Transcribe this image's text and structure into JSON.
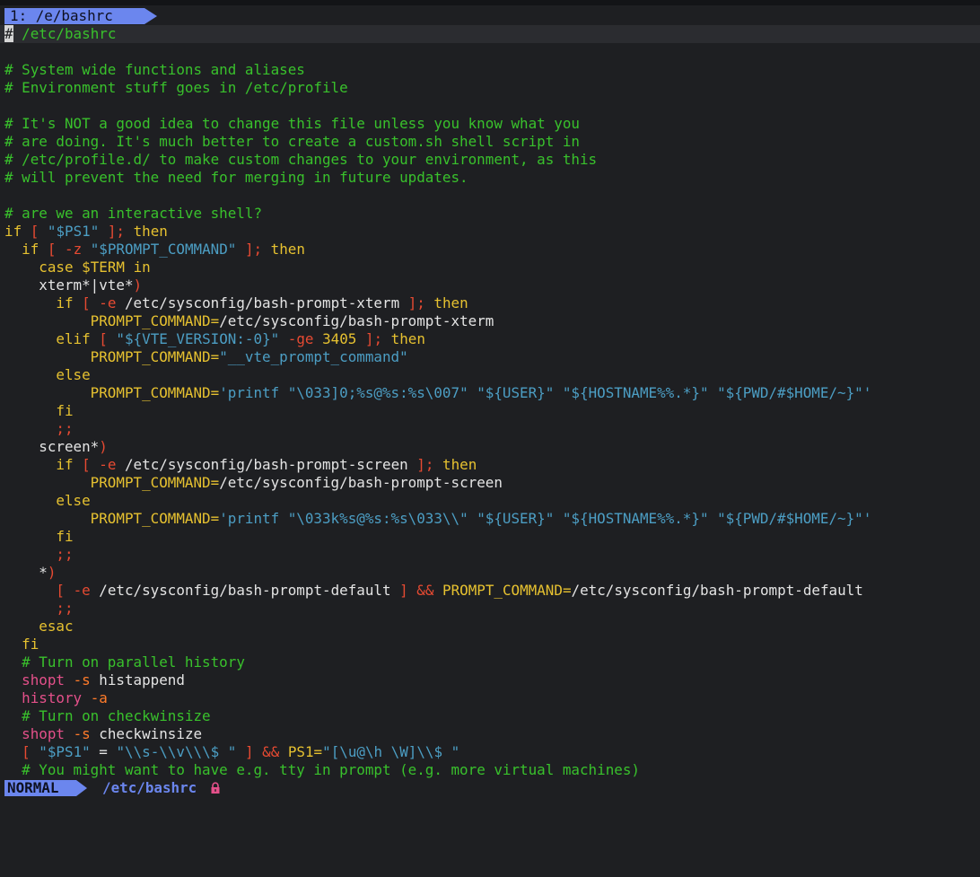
{
  "tabline": {
    "tab_label": "1: /e/bashrc"
  },
  "editor": {
    "lines": [
      [
        [
          "# ",
          "c"
        ],
        [
          "/etc/bashrc",
          "c"
        ]
      ],
      [],
      [
        [
          "# System wide functions and aliases",
          "c"
        ]
      ],
      [
        [
          "# Environment stuff goes in /etc/profile",
          "c"
        ]
      ],
      [],
      [
        [
          "# It's NOT a good idea to change this file unless you know what you",
          "c"
        ]
      ],
      [
        [
          "# are doing. It's much better to create a custom.sh shell script in",
          "c"
        ]
      ],
      [
        [
          "# /etc/profile.d/ to make custom changes to your environment, as this",
          "c"
        ]
      ],
      [
        [
          "# will prevent the need for merging in future updates.",
          "c"
        ]
      ],
      [],
      [
        [
          "# are we an interactive shell?",
          "c"
        ]
      ],
      [
        [
          "if",
          "k"
        ],
        [
          " ",
          "v"
        ],
        [
          "[",
          "o"
        ],
        [
          " ",
          "v"
        ],
        [
          "\"$PS1\"",
          "s"
        ],
        [
          " ",
          "v"
        ],
        [
          "];",
          "o"
        ],
        [
          " ",
          "v"
        ],
        [
          "then",
          "k"
        ]
      ],
      [
        [
          "  ",
          "v"
        ],
        [
          "if",
          "k"
        ],
        [
          " ",
          "v"
        ],
        [
          "[",
          "o"
        ],
        [
          " ",
          "v"
        ],
        [
          "-z",
          "o"
        ],
        [
          " ",
          "v"
        ],
        [
          "\"$PROMPT_COMMAND\"",
          "s"
        ],
        [
          " ",
          "v"
        ],
        [
          "];",
          "o"
        ],
        [
          " ",
          "v"
        ],
        [
          "then",
          "k"
        ]
      ],
      [
        [
          "    ",
          "v"
        ],
        [
          "case",
          "k"
        ],
        [
          " ",
          "v"
        ],
        [
          "$TERM",
          "k"
        ],
        [
          " ",
          "v"
        ],
        [
          "in",
          "k"
        ]
      ],
      [
        [
          "    xterm*|vte*",
          "v"
        ],
        [
          ")",
          "o"
        ]
      ],
      [
        [
          "      ",
          "v"
        ],
        [
          "if",
          "k"
        ],
        [
          " ",
          "v"
        ],
        [
          "[",
          "o"
        ],
        [
          " ",
          "v"
        ],
        [
          "-e",
          "o"
        ],
        [
          " /etc/sysconfig/bash-prompt-xterm ",
          "v"
        ],
        [
          "];",
          "o"
        ],
        [
          " ",
          "v"
        ],
        [
          "then",
          "k"
        ]
      ],
      [
        [
          "          ",
          "v"
        ],
        [
          "PROMPT_COMMAND=",
          "k"
        ],
        [
          "/etc/sysconfig/bash-prompt-xterm",
          "v"
        ]
      ],
      [
        [
          "      ",
          "v"
        ],
        [
          "elif",
          "k"
        ],
        [
          " ",
          "v"
        ],
        [
          "[",
          "o"
        ],
        [
          " ",
          "v"
        ],
        [
          "\"${VTE_VERSION:-0}\"",
          "s"
        ],
        [
          " ",
          "v"
        ],
        [
          "-ge",
          "o"
        ],
        [
          " ",
          "v"
        ],
        [
          "3405",
          "n"
        ],
        [
          " ",
          "v"
        ],
        [
          "];",
          "o"
        ],
        [
          " ",
          "v"
        ],
        [
          "then",
          "k"
        ]
      ],
      [
        [
          "          ",
          "v"
        ],
        [
          "PROMPT_COMMAND=",
          "k"
        ],
        [
          "\"__vte_prompt_command\"",
          "s"
        ]
      ],
      [
        [
          "      ",
          "v"
        ],
        [
          "else",
          "k"
        ]
      ],
      [
        [
          "          ",
          "v"
        ],
        [
          "PROMPT_COMMAND=",
          "k"
        ],
        [
          "'printf \"\\033]0;%s@%s:%s\\007\" \"${USER}\" \"${HOSTNAME%%.*}\" \"${PWD/#$HOME/~}\"'",
          "s"
        ]
      ],
      [
        [
          "      ",
          "v"
        ],
        [
          "fi",
          "k"
        ]
      ],
      [
        [
          "      ",
          "v"
        ],
        [
          ";;",
          "fl"
        ]
      ],
      [
        [
          "    screen*",
          "v"
        ],
        [
          ")",
          "o"
        ]
      ],
      [
        [
          "      ",
          "v"
        ],
        [
          "if",
          "k"
        ],
        [
          " ",
          "v"
        ],
        [
          "[",
          "o"
        ],
        [
          " ",
          "v"
        ],
        [
          "-e",
          "o"
        ],
        [
          " /etc/sysconfig/bash-prompt-screen ",
          "v"
        ],
        [
          "];",
          "o"
        ],
        [
          " ",
          "v"
        ],
        [
          "then",
          "k"
        ]
      ],
      [
        [
          "          ",
          "v"
        ],
        [
          "PROMPT_COMMAND=",
          "k"
        ],
        [
          "/etc/sysconfig/bash-prompt-screen",
          "v"
        ]
      ],
      [
        [
          "      ",
          "v"
        ],
        [
          "else",
          "k"
        ]
      ],
      [
        [
          "          ",
          "v"
        ],
        [
          "PROMPT_COMMAND=",
          "k"
        ],
        [
          "'printf \"\\033k%s@%s:%s\\033\\\\\" \"${USER}\" \"${HOSTNAME%%.*}\" \"${PWD/#$HOME/~}\"'",
          "s"
        ]
      ],
      [
        [
          "      ",
          "v"
        ],
        [
          "fi",
          "k"
        ]
      ],
      [
        [
          "      ",
          "v"
        ],
        [
          ";;",
          "fl"
        ]
      ],
      [
        [
          "    *",
          "v"
        ],
        [
          ")",
          "o"
        ]
      ],
      [
        [
          "      ",
          "v"
        ],
        [
          "[",
          "o"
        ],
        [
          " ",
          "v"
        ],
        [
          "-e",
          "o"
        ],
        [
          " /etc/sysconfig/bash-prompt-default ",
          "v"
        ],
        [
          "]",
          "o"
        ],
        [
          " ",
          "v"
        ],
        [
          "&&",
          "o"
        ],
        [
          " ",
          "v"
        ],
        [
          "PROMPT_COMMAND=",
          "k"
        ],
        [
          "/etc/sysconfig/bash-prompt-default",
          "v"
        ]
      ],
      [
        [
          "      ",
          "v"
        ],
        [
          ";;",
          "fl"
        ]
      ],
      [
        [
          "    ",
          "v"
        ],
        [
          "esac",
          "k"
        ]
      ],
      [
        [
          "  ",
          "v"
        ],
        [
          "fi",
          "k"
        ]
      ],
      [
        [
          "  ",
          "v"
        ],
        [
          "# Turn on parallel history",
          "c"
        ]
      ],
      [
        [
          "  ",
          "v"
        ],
        [
          "shopt",
          "cm"
        ],
        [
          " ",
          "v"
        ],
        [
          "-s",
          "e"
        ],
        [
          " histappend",
          "v"
        ]
      ],
      [
        [
          "  ",
          "v"
        ],
        [
          "history",
          "cm"
        ],
        [
          " ",
          "v"
        ],
        [
          "-a",
          "e"
        ]
      ],
      [
        [
          "  ",
          "v"
        ],
        [
          "# Turn on checkwinsize",
          "c"
        ]
      ],
      [
        [
          "  ",
          "v"
        ],
        [
          "shopt",
          "cm"
        ],
        [
          " ",
          "v"
        ],
        [
          "-s",
          "e"
        ],
        [
          " checkwinsize",
          "v"
        ]
      ],
      [
        [
          "  ",
          "v"
        ],
        [
          "[",
          "o"
        ],
        [
          " ",
          "v"
        ],
        [
          "\"$PS1\"",
          "s"
        ],
        [
          " ",
          "v"
        ],
        [
          "=",
          "v"
        ],
        [
          " ",
          "v"
        ],
        [
          "\"\\\\s-\\\\v\\\\\\$ \"",
          "s"
        ],
        [
          " ",
          "v"
        ],
        [
          "]",
          "o"
        ],
        [
          " ",
          "v"
        ],
        [
          "&&",
          "o"
        ],
        [
          " ",
          "v"
        ],
        [
          "PS1=",
          "k"
        ],
        [
          "\"[\\u@\\h \\W]\\\\$ \"",
          "s"
        ]
      ],
      [
        [
          "  ",
          "v"
        ],
        [
          "# You might want to have e.g. tty in prompt (e.g. more virtual machines)",
          "c"
        ]
      ]
    ]
  },
  "statusline": {
    "mode": "NORMAL",
    "filename": "/etc/bashrc",
    "readonly_icon": "lock-icon"
  },
  "colors": {
    "background": "#1e1f22",
    "accent": "#6b86ee",
    "comment": "#39c12c",
    "keyword": "#e6c130",
    "operator": "#e64a32",
    "string": "#4c9ec4",
    "command": "#e4508a"
  }
}
